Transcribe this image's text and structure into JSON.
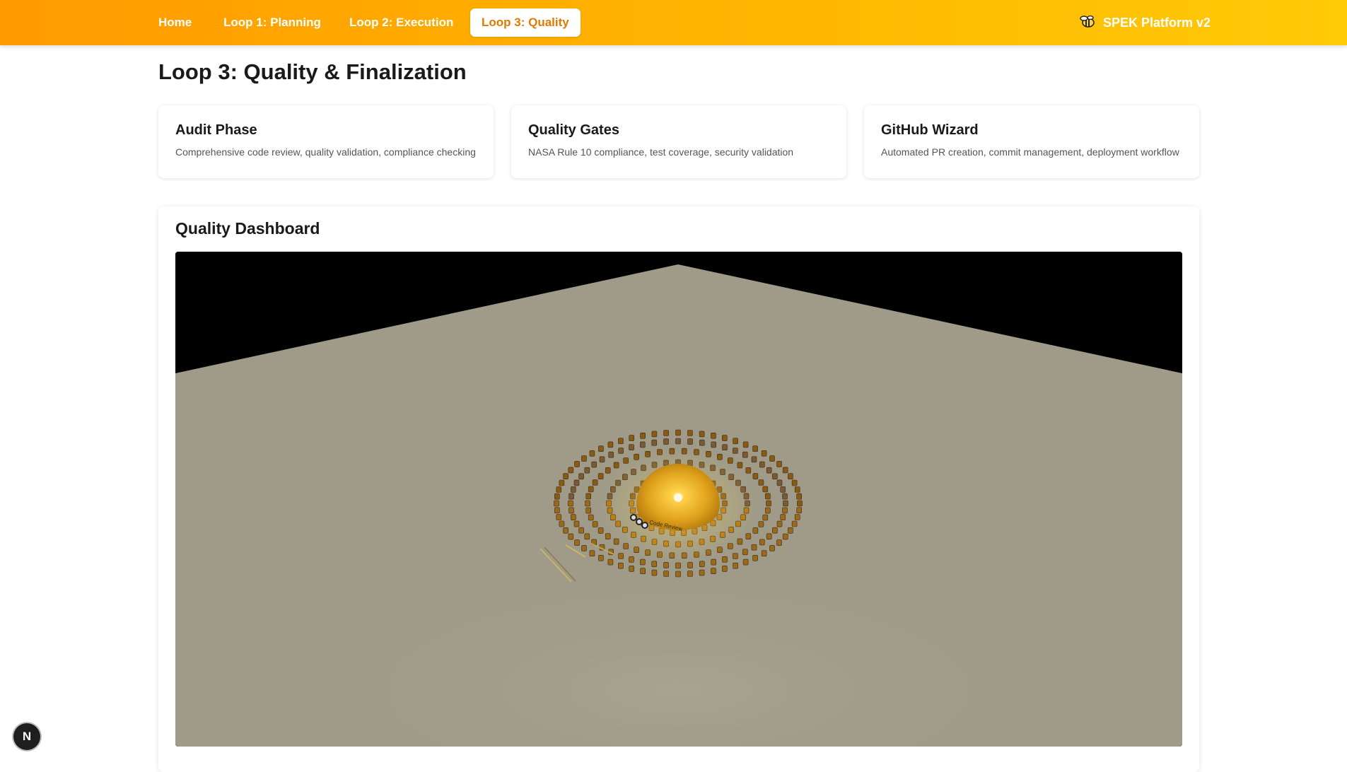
{
  "nav": {
    "links": [
      {
        "label": "Home"
      },
      {
        "label": "Loop 1: Planning"
      },
      {
        "label": "Loop 2: Execution"
      },
      {
        "label": "Loop 3: Quality",
        "active": true
      }
    ],
    "brand": "SPEK Platform v2",
    "brand_icon": "bee-icon"
  },
  "page": {
    "title": "Loop 3: Quality & Finalization"
  },
  "cards": [
    {
      "title": "Audit Phase",
      "description": "Comprehensive code review, quality validation, compliance checking"
    },
    {
      "title": "Quality Gates",
      "description": "NASA Rule 10 compliance, test coverage, security validation"
    },
    {
      "title": "GitHub Wizard",
      "description": "Automated PR creation, commit management, deployment workflow"
    }
  ],
  "dashboard": {
    "title": "Quality Dashboard",
    "scene_label": "Code Review",
    "colors": {
      "floor": "#9f9b88",
      "sky": "#000000",
      "sphere": "#e0a21c",
      "blocks": "#8a5a14"
    }
  },
  "dev_badge": {
    "label": "N",
    "icon": "nextjs-icon"
  },
  "theme": {
    "accent_start": "#ff9a00",
    "accent_end": "#ffca08",
    "active_text": "#e07a00"
  }
}
